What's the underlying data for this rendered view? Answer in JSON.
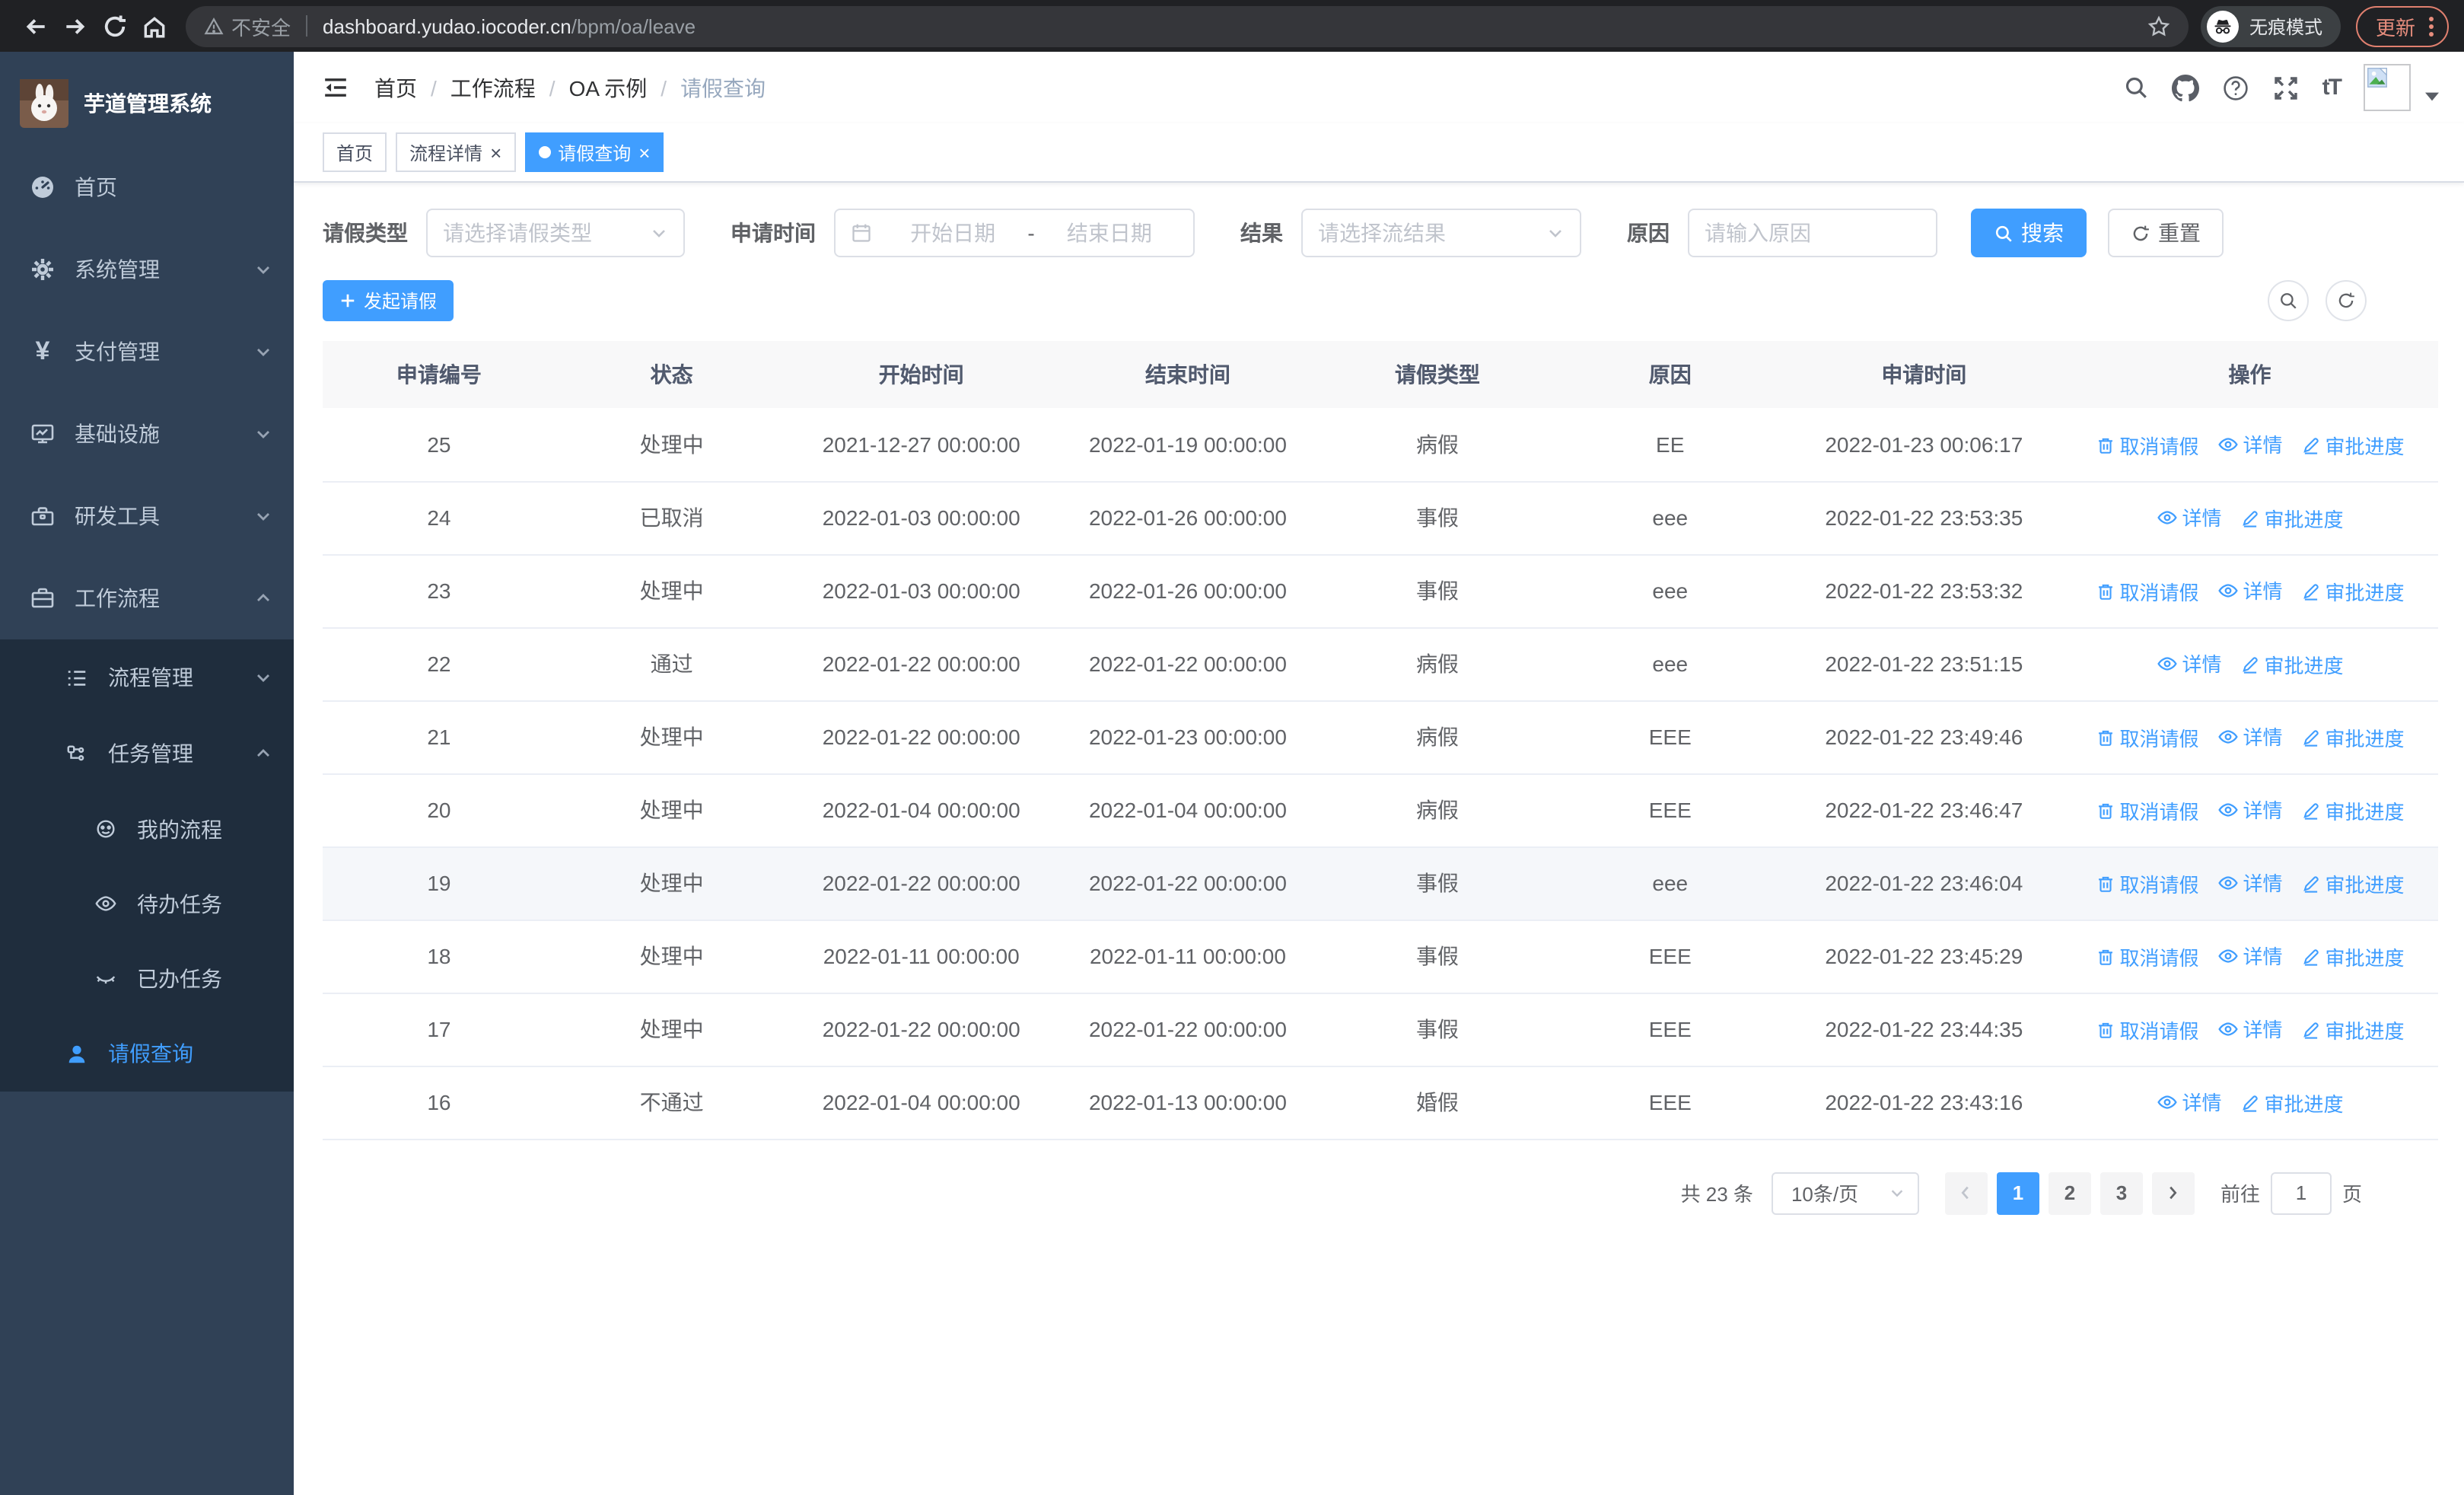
{
  "colors": {
    "accent": "#409eff",
    "sidebar_bg": "#304156",
    "submenu_bg": "#1f2d3d",
    "update_pill": "#e78d7d"
  },
  "glyphs": {
    "close": "×",
    "dash": "-",
    "yen": "¥",
    "font_size": "tT",
    "question": "?"
  },
  "browser": {
    "security_warning": "不安全",
    "url_host": "dashboard.yudao.iocoder.cn",
    "url_path": "/bpm/oa/leave",
    "incognito_label": "无痕模式",
    "update_label": "更新"
  },
  "sidebar": {
    "title": "芋道管理系统",
    "items": {
      "home": "首页",
      "system": "系统管理",
      "payment": "支付管理",
      "infra": "基础设施",
      "devtools": "研发工具",
      "workflow": "工作流程",
      "process_mgmt": "流程管理",
      "task_mgmt": "任务管理",
      "my_process": "我的流程",
      "todo_tasks": "待办任务",
      "done_tasks": "已办任务",
      "leave_query": "请假查询"
    }
  },
  "header": {
    "breadcrumb": [
      "首页",
      "工作流程",
      "OA 示例",
      "请假查询"
    ],
    "separator": "/"
  },
  "tabs": [
    {
      "label": "首页"
    },
    {
      "label": "流程详情"
    },
    {
      "label": "请假查询"
    }
  ],
  "filters": {
    "type_label": "请假类型",
    "type_placeholder": "请选择请假类型",
    "time_label": "申请时间",
    "start_placeholder": "开始日期",
    "range_separator": "-",
    "end_placeholder": "结束日期",
    "result_label": "结果",
    "result_placeholder": "请选择流结果",
    "reason_label": "原因",
    "reason_placeholder": "请输入原因",
    "search_button": "搜索",
    "reset_button": "重置"
  },
  "toolbar": {
    "create_button": "发起请假"
  },
  "table": {
    "columns": [
      "申请编号",
      "状态",
      "开始时间",
      "结束时间",
      "请假类型",
      "原因",
      "申请时间",
      "操作"
    ],
    "action_labels": {
      "cancel": "取消请假",
      "detail": "详情",
      "progress": "审批进度"
    },
    "rows": [
      {
        "id": "25",
        "status": "处理中",
        "start": "2021-12-27 00:00:00",
        "end": "2022-01-19 00:00:00",
        "type": "病假",
        "reason": "EE",
        "apply_time": "2022-01-23 00:06:17",
        "actions": [
          "cancel",
          "detail",
          "progress"
        ]
      },
      {
        "id": "24",
        "status": "已取消",
        "start": "2022-01-03 00:00:00",
        "end": "2022-01-26 00:00:00",
        "type": "事假",
        "reason": "eee",
        "apply_time": "2022-01-22 23:53:35",
        "actions": [
          "detail",
          "progress"
        ]
      },
      {
        "id": "23",
        "status": "处理中",
        "start": "2022-01-03 00:00:00",
        "end": "2022-01-26 00:00:00",
        "type": "事假",
        "reason": "eee",
        "apply_time": "2022-01-22 23:53:32",
        "actions": [
          "cancel",
          "detail",
          "progress"
        ]
      },
      {
        "id": "22",
        "status": "通过",
        "start": "2022-01-22 00:00:00",
        "end": "2022-01-22 00:00:00",
        "type": "病假",
        "reason": "eee",
        "apply_time": "2022-01-22 23:51:15",
        "actions": [
          "detail",
          "progress"
        ]
      },
      {
        "id": "21",
        "status": "处理中",
        "start": "2022-01-22 00:00:00",
        "end": "2022-01-23 00:00:00",
        "type": "病假",
        "reason": "EEE",
        "apply_time": "2022-01-22 23:49:46",
        "actions": [
          "cancel",
          "detail",
          "progress"
        ]
      },
      {
        "id": "20",
        "status": "处理中",
        "start": "2022-01-04 00:00:00",
        "end": "2022-01-04 00:00:00",
        "type": "病假",
        "reason": "EEE",
        "apply_time": "2022-01-22 23:46:47",
        "actions": [
          "cancel",
          "detail",
          "progress"
        ]
      },
      {
        "id": "19",
        "status": "处理中",
        "start": "2022-01-22 00:00:00",
        "end": "2022-01-22 00:00:00",
        "type": "事假",
        "reason": "eee",
        "apply_time": "2022-01-22 23:46:04",
        "actions": [
          "cancel",
          "detail",
          "progress"
        ],
        "highlighted": true
      },
      {
        "id": "18",
        "status": "处理中",
        "start": "2022-01-11 00:00:00",
        "end": "2022-01-11 00:00:00",
        "type": "事假",
        "reason": "EEE",
        "apply_time": "2022-01-22 23:45:29",
        "actions": [
          "cancel",
          "detail",
          "progress"
        ]
      },
      {
        "id": "17",
        "status": "处理中",
        "start": "2022-01-22 00:00:00",
        "end": "2022-01-22 00:00:00",
        "type": "事假",
        "reason": "EEE",
        "apply_time": "2022-01-22 23:44:35",
        "actions": [
          "cancel",
          "detail",
          "progress"
        ]
      },
      {
        "id": "16",
        "status": "不通过",
        "start": "2022-01-04 00:00:00",
        "end": "2022-01-13 00:00:00",
        "type": "婚假",
        "reason": "EEE",
        "apply_time": "2022-01-22 23:43:16",
        "actions": [
          "detail",
          "progress"
        ]
      }
    ]
  },
  "pagination": {
    "total_text": "共 23 条",
    "page_size": "10条/页",
    "pages": [
      "1",
      "2",
      "3"
    ],
    "active_page": "1",
    "goto_label": "前往",
    "goto_value": "1",
    "goto_suffix": "页"
  }
}
